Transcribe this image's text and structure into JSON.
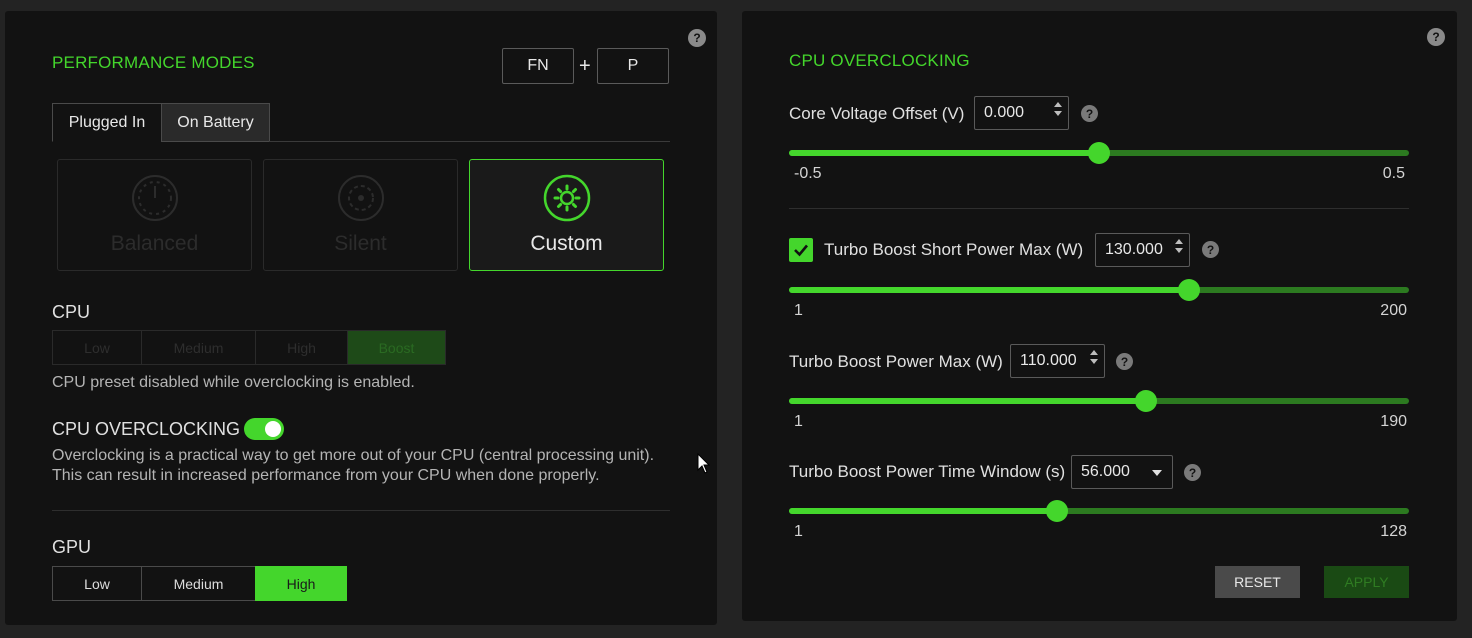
{
  "performance": {
    "title": "PERFORMANCE MODES",
    "help_icon": "?",
    "keybind": {
      "key1": "FN",
      "plus": "+",
      "key2": "P"
    },
    "tabs": [
      {
        "label": "Plugged In",
        "active": true
      },
      {
        "label": "On Battery",
        "active": false
      }
    ],
    "modes": [
      {
        "label": "Balanced",
        "icon": "gauge-icon",
        "state": "disabled"
      },
      {
        "label": "Silent",
        "icon": "fan-icon",
        "state": "disabled"
      },
      {
        "label": "Custom",
        "icon": "gear-icon",
        "state": "selected"
      }
    ],
    "cpu": {
      "label": "CPU",
      "options": [
        "Low",
        "Medium",
        "High",
        "Boost"
      ],
      "selected": "Boost",
      "disabled": true,
      "note": "CPU preset disabled while overclocking is enabled."
    },
    "overclocking": {
      "label": "CPU OVERCLOCKING",
      "enabled": true,
      "description": "Overclocking is a practical way to get more out of your CPU (central processing unit). This can result in increased performance from your CPU when done properly."
    },
    "gpu": {
      "label": "GPU",
      "options": [
        "Low",
        "Medium",
        "High"
      ],
      "selected": "High"
    }
  },
  "cpu_oc": {
    "title": "CPU OVERCLOCKING",
    "help_icon": "?",
    "core_voltage": {
      "label": "Core Voltage Offset (V)",
      "value": "0.000",
      "min_label": "-0.5",
      "max_label": "0.5",
      "fraction": 0.5
    },
    "turbo_short": {
      "checked": true,
      "label": "Turbo Boost Short Power Max (W)",
      "value": "130.000",
      "min_label": "1",
      "max_label": "200",
      "fraction": 0.645
    },
    "turbo_power": {
      "label": "Turbo Boost Power Max (W)",
      "value": "110.000",
      "min_label": "1",
      "max_label": "190",
      "fraction": 0.576
    },
    "turbo_window": {
      "label": "Turbo Boost Power Time Window (s)",
      "value": "56.000",
      "min_label": "1",
      "max_label": "128",
      "fraction": 0.433
    },
    "reset_label": "RESET",
    "apply_label": "APPLY"
  },
  "colors": {
    "accent": "#44d62c",
    "panel": "#121212",
    "background": "#232323"
  }
}
